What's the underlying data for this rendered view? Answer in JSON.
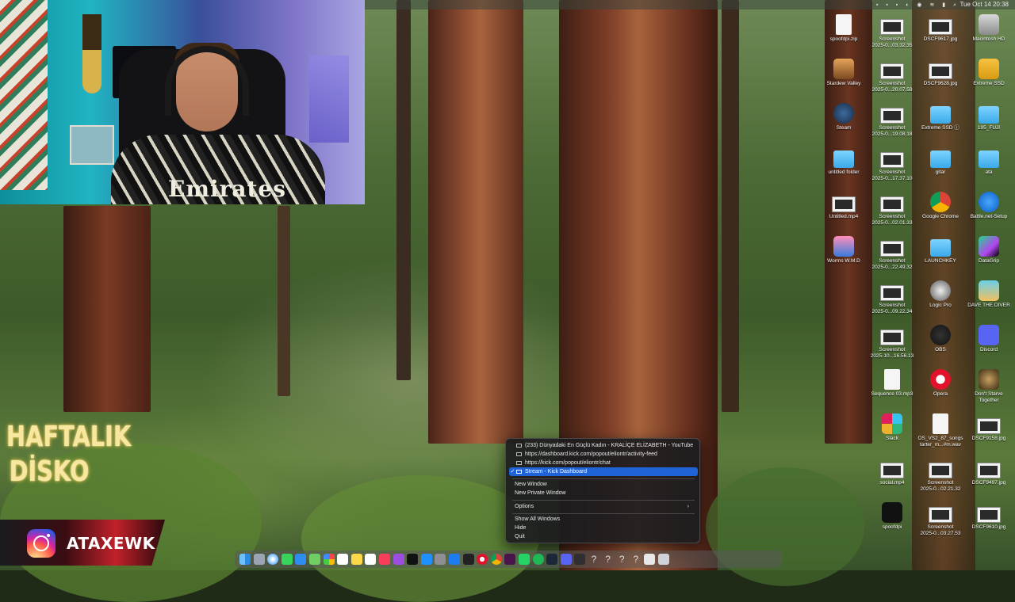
{
  "menubar": {
    "clock": "Tue Oct 14  20:38"
  },
  "overlay": {
    "show_title_lines": [
      "HAFTALIK",
      "DİSKO"
    ],
    "instagram_handle": "ATAXEWK",
    "shirt_text": "Emirates"
  },
  "desktop_icons": [
    {
      "label": "spoofdpi.zip",
      "icon": "zip-file-icon"
    },
    {
      "label": "Screenshot\n2025-0...03.32.35",
      "icon": "screenshot-icon"
    },
    {
      "label": "DSCF9617.jpg",
      "icon": "photo-icon"
    },
    {
      "label": "Macintosh HD",
      "icon": "hard-drive-icon"
    },
    {
      "label": "Stardew Valley",
      "icon": "stardew-icon"
    },
    {
      "label": "Screenshot\n2025-0...20.07.58",
      "icon": "screenshot-icon"
    },
    {
      "label": "DSCF9628.jpg",
      "icon": "photo-icon"
    },
    {
      "label": "Extreme SSD",
      "icon": "external-drive-icon"
    },
    {
      "label": "Steam",
      "icon": "steam-icon"
    },
    {
      "label": "Screenshot\n2025-0...19.08.18",
      "icon": "screenshot-icon"
    },
    {
      "label": "Extreme SSD ⓘ",
      "icon": "folder-icon"
    },
    {
      "label": "195_FUJI",
      "icon": "folder-icon"
    },
    {
      "label": "untitled folder",
      "icon": "folder-icon"
    },
    {
      "label": "Screenshot\n2025-0...17.37.10",
      "icon": "screenshot-icon"
    },
    {
      "label": "gitar",
      "icon": "folder-icon"
    },
    {
      "label": "ata",
      "icon": "folder-icon"
    },
    {
      "label": "Untitled.mp4",
      "icon": "video-icon"
    },
    {
      "label": "Screenshot\n2025-0...02.01.33",
      "icon": "screenshot-icon"
    },
    {
      "label": "Google Chrome",
      "icon": "chrome-icon"
    },
    {
      "label": "Battle.net-Setup",
      "icon": "battlenet-icon"
    },
    {
      "label": "Worms W.M.D",
      "icon": "worms-icon"
    },
    {
      "label": "Screenshot\n2025-0...22.49.32",
      "icon": "screenshot-icon"
    },
    {
      "label": "LAUNCHKEY",
      "icon": "folder-icon"
    },
    {
      "label": "DataGrip",
      "icon": "datagrip-icon"
    },
    {
      "label": "Screenshot\n2025-0...09.22.34",
      "icon": "screenshot-icon"
    },
    {
      "label": "Logic Pro",
      "icon": "logic-pro-icon"
    },
    {
      "label": "DAVE THE DIVER",
      "icon": "dave-the-diver-icon"
    },
    {
      "label": "Screenshot\n2025-10...16.56.13",
      "icon": "screenshot-icon"
    },
    {
      "label": "OBS",
      "icon": "obs-icon"
    },
    {
      "label": "Discord",
      "icon": "discord-icon"
    },
    {
      "label": "Sequence 03.mp3",
      "icon": "audio-file-icon"
    },
    {
      "label": "Opera",
      "icon": "opera-icon"
    },
    {
      "label": "Don't Starve\nTogether",
      "icon": "dont-starve-icon"
    },
    {
      "label": "Slack",
      "icon": "slack-icon"
    },
    {
      "label": "OS_VS2_87_songs\ntarter_m...#m.wav",
      "icon": "audio-file-icon"
    },
    {
      "label": "DSCF9158.jpg",
      "icon": "photo-icon"
    },
    {
      "label": "social.mp4",
      "icon": "video-icon"
    },
    {
      "label": "Screenshot\n2025-0...02.21.32",
      "icon": "screenshot-icon"
    },
    {
      "label": "DSCF9497.jpg",
      "icon": "photo-icon"
    },
    {
      "label": "spoofdpi",
      "icon": "terminal-icon"
    },
    {
      "label": "Screenshot\n2025-0...03.27.53",
      "icon": "screenshot-icon"
    },
    {
      "label": "DSCF9610.jpg",
      "icon": "photo-icon"
    }
  ],
  "context_menu": {
    "windows": [
      {
        "label": "(233) Dünyadaki En Güçlü Kadın - KRALİÇE ELİZABETH - YouTube",
        "checked": false
      },
      {
        "label": "https://dashboard.kick.com/popout/eliontr/activity-feed",
        "checked": false
      },
      {
        "label": "https://kick.com/popout/eliontr/chat",
        "checked": false
      },
      {
        "label": "Stream - Kick Dashboard",
        "checked": true
      }
    ],
    "check_mark": "✓",
    "new_window": "New Window",
    "new_private_window": "New Private Window",
    "options": "Options",
    "options_arrow": "›",
    "show_all_windows": "Show All Windows",
    "hide": "Hide",
    "quit": "Quit"
  },
  "dock": {
    "apps": [
      "finder",
      "launchpad",
      "safari",
      "messages",
      "mail",
      "maps",
      "photos",
      "calendar",
      "notes",
      "reminders",
      "music",
      "podcasts",
      "tv",
      "appstore",
      "settings",
      "xcode",
      "terminal",
      "opera",
      "chrome",
      "slack",
      "whatsapp",
      "spotify",
      "steam",
      "discord",
      "obs",
      "unknown",
      "unknown",
      "unknown",
      "unknown",
      "preview",
      "trash"
    ],
    "unknown_glyph": "?"
  }
}
